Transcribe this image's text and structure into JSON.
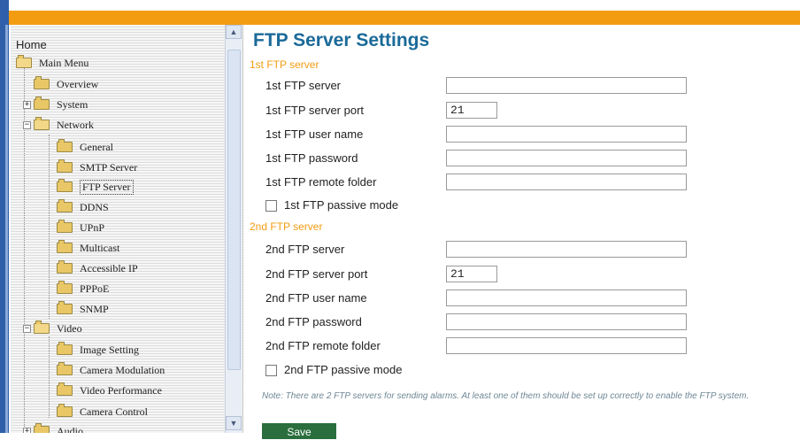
{
  "sidebar": {
    "home": "Home",
    "main_menu": "Main Menu",
    "items": {
      "overview": "Overview",
      "system": "System",
      "network": "Network",
      "general": "General",
      "smtp_server": "SMTP Server",
      "ftp_server": "FTP Server",
      "ddns": "DDNS",
      "upnp": "UPnP",
      "multicast": "Multicast",
      "accessible_ip": "Accessible IP",
      "pppoe": "PPPoE",
      "snmp": "SNMP",
      "video": "Video",
      "image_setting": "Image Setting",
      "camera_modulation": "Camera Modulation",
      "video_performance": "Video Performance",
      "camera_control": "Camera Control",
      "audio": "Audio"
    }
  },
  "page": {
    "title": "FTP Server Settings",
    "section1": {
      "title": "1st FTP server",
      "server_label": "1st FTP server",
      "server_value": "",
      "port_label": "1st FTP server port",
      "port_value": "21",
      "user_label": "1st FTP user name",
      "user_value": "",
      "password_label": "1st FTP password",
      "password_value": "",
      "folder_label": "1st FTP remote folder",
      "folder_value": "",
      "passive_label": "1st FTP passive mode",
      "passive_checked": false
    },
    "section2": {
      "title": "2nd FTP server",
      "server_label": "2nd FTP server",
      "server_value": "",
      "port_label": "2nd FTP server port",
      "port_value": "21",
      "user_label": "2nd FTP user name",
      "user_value": "",
      "password_label": "2nd FTP password",
      "password_value": "",
      "folder_label": "2nd FTP remote folder",
      "folder_value": "",
      "passive_label": "2nd FTP passive mode",
      "passive_checked": false
    },
    "note": "Note: There are 2 FTP servers for sending alarms. At least one of them should be set up correctly to enable the FTP system.",
    "save_label": "Save"
  },
  "colors": {
    "header_band": "#f39c12",
    "title": "#1a6a99",
    "section": "#f39c12",
    "save_button": "#2a6e3d"
  }
}
